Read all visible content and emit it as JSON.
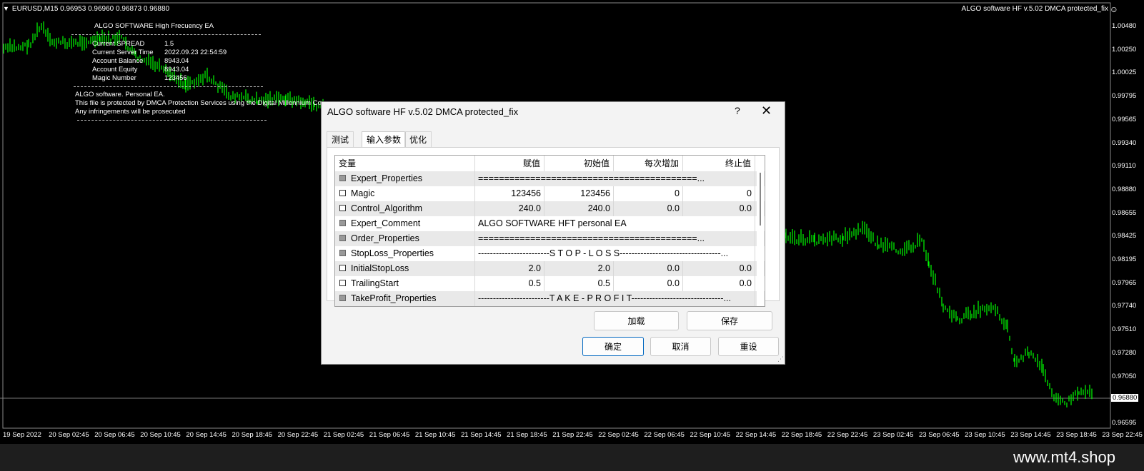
{
  "chart": {
    "symbol_info": "EURUSD,M15  0.96953 0.96960 0.96873 0.96880",
    "ea_label": "ALGO software HF v.5.02 DMCA protected_fix",
    "current_price": "0.96880",
    "price_ticks": [
      "1.00480",
      "1.00250",
      "1.00025",
      "0.99795",
      "0.99565",
      "0.99340",
      "0.99110",
      "0.98880",
      "0.98655",
      "0.98425",
      "0.98195",
      "0.97965",
      "0.97740",
      "0.97510",
      "0.97280",
      "0.97050",
      "0.96825",
      "0.96595"
    ],
    "time_ticks": [
      "19 Sep 2022",
      "20 Sep 02:45",
      "20 Sep 06:45",
      "20 Sep 10:45",
      "20 Sep 14:45",
      "20 Sep 18:45",
      "20 Sep 22:45",
      "21 Sep 02:45",
      "21 Sep 06:45",
      "21 Sep 10:45",
      "21 Sep 14:45",
      "21 Sep 18:45",
      "21 Sep 22:45",
      "22 Sep 02:45",
      "22 Sep 06:45",
      "22 Sep 10:45",
      "22 Sep 14:45",
      "22 Sep 18:45",
      "22 Sep 22:45",
      "23 Sep 02:45",
      "23 Sep 06:45",
      "23 Sep 10:45",
      "23 Sep 14:45",
      "23 Sep 18:45",
      "23 Sep 22:45"
    ],
    "colors": {
      "candle": "#00ff00",
      "background": "#000000",
      "text": "#ffffff"
    }
  },
  "overlay": {
    "title": "ALGO SOFTWARE High Frecuency EA",
    "rows": [
      {
        "label": "Current SPREAD",
        "value": "1.5"
      },
      {
        "label": "Current Server Time",
        "value": "2022.09.23 22:54:59"
      },
      {
        "label": "Account Balance",
        "value": "8943.04"
      },
      {
        "label": "Account Equity",
        "value": "8943.04"
      },
      {
        "label": "Magic Number",
        "value": "123456"
      }
    ],
    "notice_1": "ALGO software. Personal EA.",
    "notice_2": "This file is protected by DMCA Protection Services using the Digital Millennium Copy",
    "notice_3": "Any infringements will be prosecuted"
  },
  "dialog": {
    "title": "ALGO software HF v.5.02 DMCA protected_fix",
    "help": "?",
    "close": "✕",
    "tabs": [
      {
        "label": "测试"
      },
      {
        "label": "输入参数",
        "active": true
      },
      {
        "label": "优化"
      }
    ],
    "columns": [
      "变量",
      "赋值",
      "初始值",
      "每次增加",
      "终止值"
    ],
    "params": [
      {
        "name": "Expert_Properties",
        "grey": true,
        "span": "==========================================..."
      },
      {
        "name": "Magic",
        "grey": false,
        "value": "123456",
        "start": "123456",
        "step": "0",
        "stop": "0"
      },
      {
        "name": "Control_Algorithm",
        "grey": false,
        "value": "240.0",
        "start": "240.0",
        "step": "0.0",
        "stop": "0.0"
      },
      {
        "name": "Expert_Comment",
        "grey": true,
        "span": "ALGO SOFTWARE HFT personal EA"
      },
      {
        "name": "Order_Properties",
        "grey": true,
        "span": "==========================================..."
      },
      {
        "name": "StopLoss_Properties",
        "grey": true,
        "span": "------------------------S T O P - L O S S----------------------------------..."
      },
      {
        "name": "InitialStopLoss",
        "grey": false,
        "value": "2.0",
        "start": "2.0",
        "step": "0.0",
        "stop": "0.0"
      },
      {
        "name": "TrailingStart",
        "grey": false,
        "value": "0.5",
        "start": "0.5",
        "step": "0.0",
        "stop": "0.0"
      },
      {
        "name": "TakeProfit_Properties",
        "grey": true,
        "span": "------------------------T A K E - P R O F I T-------------------------------..."
      }
    ],
    "buttons": {
      "load": "加载",
      "save": "保存",
      "ok": "确定",
      "cancel": "取消",
      "reset": "重设"
    }
  },
  "brand": "www.mt4.shop"
}
